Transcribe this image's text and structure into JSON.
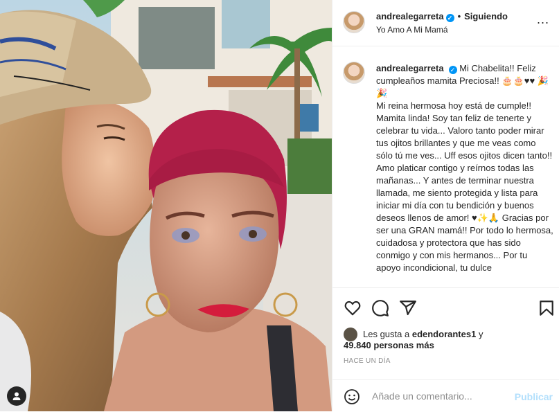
{
  "post": {
    "username": "andrealegarreta",
    "follow_status": "Siguiendo",
    "separator": "•",
    "audio_label": "Yo Amo A Mi Mamá",
    "more_label": "...",
    "caption_paragraphs": [
      "Mi Chabelita!! Feliz cumpleaños mamita Preciosa!! 🎂🎂♥♥ 🎉🎉",
      "Mi reina hermosa hoy está de cumple!! Mamita linda! Soy tan feliz de tenerte y celebrar tu vida... Valoro tanto poder mirar tus ojitos brillantes y que me veas como sólo tú me ves... Uff esos ojitos dicen tanto!!",
      "Amo platicar contigo y reírnos todas las mañanas... Y antes de terminar nuestra llamada, me siento protegida y lista para iniciar mi día con tu bendición y buenos deseos llenos de amor! ♥✨🙏 Gracias por ser una GRAN mamá!! Por todo lo hermosa, cuidadosa y protectora que has sido conmigo y con mis hermanos... Por tu apoyo incondicional, tu dulce"
    ],
    "likes": {
      "prefix": "Les gusta a",
      "liker": "edendorantes1",
      "connector": "y",
      "others": "49.840 personas más"
    },
    "time_label": "HACE UN DÍA",
    "comment": {
      "placeholder": "Añade un comentario...",
      "publish_label": "Publicar"
    }
  },
  "colors": {
    "accent": "#0095f6",
    "publish_disabled": "#b2dffc",
    "text": "#262626",
    "muted": "#8e8e8e"
  },
  "icons": [
    "heart-icon",
    "comment-icon",
    "share-icon",
    "bookmark-icon",
    "emoji-icon",
    "user-tag-icon",
    "verified-icon"
  ]
}
